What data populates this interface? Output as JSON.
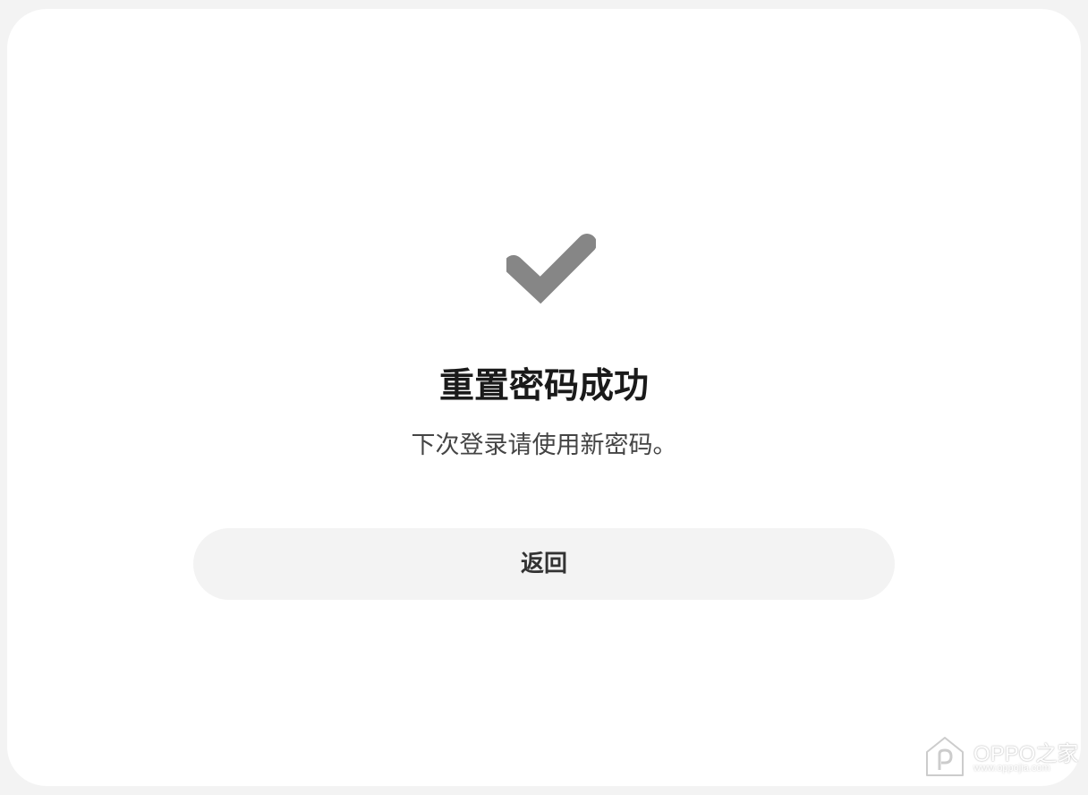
{
  "dialog": {
    "icon": "checkmark-icon",
    "title": "重置密码成功",
    "message": "下次登录请使用新密码。",
    "back_label": "返回"
  },
  "watermark": {
    "icon": "house-logo-icon",
    "brand": "OPPO之家",
    "url": "www.oppojia.com"
  },
  "colors": {
    "page_background": "#f3f3f3",
    "card_background": "#ffffff",
    "icon_color": "#868686",
    "title_color": "#1a1a1a",
    "button_background": "#f3f3f3"
  }
}
